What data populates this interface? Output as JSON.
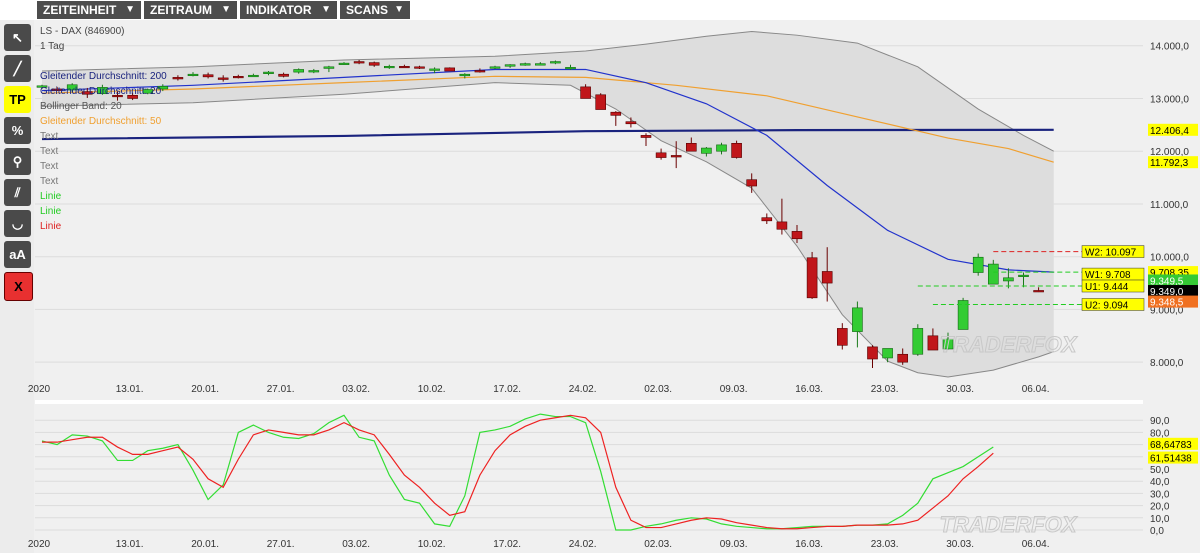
{
  "menu": [
    {
      "label": "ZEITEINHEIT"
    },
    {
      "label": "ZEITRAUM"
    },
    {
      "label": "INDIKATOR"
    },
    {
      "label": "SCANS"
    }
  ],
  "tools": [
    {
      "name": "cursor-tool-icon",
      "glyph": "↖"
    },
    {
      "name": "line-tool-icon",
      "glyph": "╱"
    },
    {
      "name": "tp-tool-button",
      "glyph": "TP"
    },
    {
      "name": "percent-tool-icon",
      "glyph": "%"
    },
    {
      "name": "zoom-tool-icon",
      "glyph": "⚲"
    },
    {
      "name": "parallel-tool-icon",
      "glyph": "⫽"
    },
    {
      "name": "curve-tool-icon",
      "glyph": "◡"
    },
    {
      "name": "text-tool-button",
      "glyph": "aA"
    },
    {
      "name": "delete-tool-button",
      "glyph": "X"
    }
  ],
  "info": {
    "symbol": "LS - DAX (846900)",
    "interval": "1 Tag"
  },
  "legend": [
    {
      "text": "Gleitender Durchschnitt: 200",
      "color": "#1a237e"
    },
    {
      "text": "Gleitender Durchschnitt: 20",
      "color": "#1a237e"
    },
    {
      "text": "Bollinger Band: 20",
      "color": "#555555"
    },
    {
      "text": "Gleitender Durchschnitt: 50",
      "color": "#f0a030"
    },
    {
      "text": "Text",
      "color": "#777777"
    },
    {
      "text": "Text",
      "color": "#777777"
    },
    {
      "text": "Text",
      "color": "#777777"
    },
    {
      "text": "Text",
      "color": "#777777"
    },
    {
      "text": "Linie",
      "color": "#22cc22"
    },
    {
      "text": "Linie",
      "color": "#22cc22"
    },
    {
      "text": "Linie",
      "color": "#dd2222"
    }
  ],
  "watermark": "TRADERFOX",
  "chart_data": [
    {
      "type": "candlestick",
      "ylim": [
        7700,
        14450
      ],
      "yticks": [
        {
          "v": 14000,
          "label": "14.000,0"
        },
        {
          "v": 13000,
          "label": "13.000,0"
        },
        {
          "v": 12000,
          "label": "12.000,0"
        },
        {
          "v": 11000,
          "label": "11.000,0"
        },
        {
          "v": 10000,
          "label": "10.000,0"
        },
        {
          "v": 9000,
          "label": "9.000,0"
        },
        {
          "v": 8000,
          "label": "8.000,0"
        }
      ],
      "xlabels": [
        {
          "i": 0,
          "label": "2020"
        },
        {
          "i": 6,
          "label": "13.01."
        },
        {
          "i": 11,
          "label": "20.01."
        },
        {
          "i": 16,
          "label": "27.01."
        },
        {
          "i": 21,
          "label": "03.02."
        },
        {
          "i": 26,
          "label": "10.02."
        },
        {
          "i": 31,
          "label": "17.02."
        },
        {
          "i": 36,
          "label": "24.02."
        },
        {
          "i": 41,
          "label": "02.03."
        },
        {
          "i": 46,
          "label": "09.03."
        },
        {
          "i": 51,
          "label": "16.03."
        },
        {
          "i": 56,
          "label": "23.03."
        },
        {
          "i": 61,
          "label": "30.03."
        },
        {
          "i": 66,
          "label": "06.04."
        }
      ],
      "ohlc": [
        [
          13220,
          13260,
          13180,
          13240
        ],
        [
          13180,
          13220,
          13140,
          13150
        ],
        [
          13160,
          13290,
          13120,
          13260
        ],
        [
          13130,
          13200,
          13010,
          13080
        ],
        [
          13090,
          13260,
          13070,
          13210
        ],
        [
          13060,
          13130,
          12960,
          13040
        ],
        [
          13060,
          13110,
          12970,
          13000
        ],
        [
          13100,
          13190,
          13080,
          13170
        ],
        [
          13180,
          13270,
          13140,
          13230
        ],
        [
          13400,
          13440,
          13340,
          13370
        ],
        [
          13460,
          13500,
          13420,
          13460
        ],
        [
          13450,
          13490,
          13380,
          13410
        ],
        [
          13390,
          13440,
          13320,
          13360
        ],
        [
          13420,
          13450,
          13380,
          13400
        ],
        [
          13440,
          13470,
          13420,
          13440
        ],
        [
          13470,
          13520,
          13440,
          13500
        ],
        [
          13460,
          13490,
          13400,
          13420
        ],
        [
          13500,
          13570,
          13470,
          13550
        ],
        [
          13520,
          13560,
          13480,
          13530
        ],
        [
          13570,
          13620,
          13500,
          13600
        ],
        [
          13660,
          13690,
          13640,
          13670
        ],
        [
          13700,
          13730,
          13650,
          13680
        ],
        [
          13680,
          13700,
          13600,
          13630
        ],
        [
          13600,
          13640,
          13560,
          13610
        ],
        [
          13610,
          13640,
          13580,
          13590
        ],
        [
          13600,
          13620,
          13560,
          13580
        ],
        [
          13540,
          13590,
          13480,
          13560
        ],
        [
          13580,
          13590,
          13520,
          13520
        ],
        [
          13430,
          13480,
          13380,
          13460
        ],
        [
          13530,
          13570,
          13490,
          13520
        ],
        [
          13590,
          13620,
          13560,
          13600
        ],
        [
          13620,
          13650,
          13580,
          13640
        ],
        [
          13650,
          13680,
          13620,
          13660
        ],
        [
          13660,
          13690,
          13630,
          13660
        ],
        [
          13690,
          13720,
          13650,
          13700
        ],
        [
          13580,
          13640,
          13540,
          13590
        ],
        [
          13220,
          13270,
          13060,
          13000
        ],
        [
          13070,
          13100,
          12890,
          12790
        ],
        [
          12740,
          12760,
          12480,
          12680
        ],
        [
          12560,
          12640,
          12450,
          12520
        ],
        [
          12300,
          12340,
          12100,
          12260
        ],
        [
          11970,
          12050,
          11840,
          11880
        ],
        [
          11920,
          12190,
          11680,
          11890
        ],
        [
          12150,
          12260,
          12020,
          12000
        ],
        [
          11960,
          12080,
          11900,
          12060
        ],
        [
          12000,
          12160,
          11940,
          12120
        ],
        [
          12150,
          12200,
          11860,
          11880
        ],
        [
          11460,
          11580,
          11210,
          11340
        ],
        [
          10740,
          10820,
          10620,
          10680
        ],
        [
          10660,
          11100,
          10420,
          10520
        ],
        [
          10480,
          10600,
          10260,
          10340
        ],
        [
          9980,
          10090,
          9200,
          9220
        ],
        [
          9720,
          10180,
          9150,
          9500
        ],
        [
          8640,
          8740,
          8240,
          8320
        ],
        [
          8580,
          9150,
          8280,
          9030
        ],
        [
          8290,
          8320,
          7890,
          8060
        ],
        [
          8080,
          8200,
          8000,
          8260
        ],
        [
          8150,
          8260,
          7950,
          8000
        ],
        [
          8150,
          8720,
          8120,
          8640
        ],
        [
          8500,
          8640,
          8240,
          8230
        ],
        [
          8250,
          8560,
          8240,
          8440
        ],
        [
          8620,
          9220,
          8750,
          9170
        ],
        [
          9700,
          10060,
          9640,
          9990
        ],
        [
          9480,
          9940,
          9500,
          9860
        ],
        [
          9540,
          9780,
          9400,
          9600
        ],
        [
          9650,
          9700,
          9420,
          9650
        ],
        [
          9360,
          9420,
          9330,
          9350
        ]
      ],
      "ma200": [
        {
          "i": 0,
          "v": 12230
        },
        {
          "i": 20,
          "v": 12290
        },
        {
          "i": 36,
          "v": 12380
        },
        {
          "i": 50,
          "v": 12400
        },
        {
          "i": 67,
          "v": 12406
        }
      ],
      "ma50": [
        {
          "i": 0,
          "v": 13100
        },
        {
          "i": 10,
          "v": 13180
        },
        {
          "i": 20,
          "v": 13300
        },
        {
          "i": 30,
          "v": 13420
        },
        {
          "i": 36,
          "v": 13400
        },
        {
          "i": 42,
          "v": 13250
        },
        {
          "i": 48,
          "v": 13050
        },
        {
          "i": 54,
          "v": 12650
        },
        {
          "i": 60,
          "v": 12250
        },
        {
          "i": 64,
          "v": 12050
        },
        {
          "i": 67,
          "v": 11792
        }
      ],
      "ma20": [
        {
          "i": 0,
          "v": 13150
        },
        {
          "i": 10,
          "v": 13250
        },
        {
          "i": 20,
          "v": 13400
        },
        {
          "i": 30,
          "v": 13550
        },
        {
          "i": 36,
          "v": 13550
        },
        {
          "i": 40,
          "v": 13300
        },
        {
          "i": 44,
          "v": 12900
        },
        {
          "i": 48,
          "v": 12300
        },
        {
          "i": 52,
          "v": 11350
        },
        {
          "i": 56,
          "v": 10500
        },
        {
          "i": 60,
          "v": 9950
        },
        {
          "i": 64,
          "v": 9750
        },
        {
          "i": 67,
          "v": 9708
        }
      ],
      "bb_upper": [
        {
          "i": 0,
          "v": 13520
        },
        {
          "i": 10,
          "v": 13600
        },
        {
          "i": 20,
          "v": 13730
        },
        {
          "i": 30,
          "v": 13800
        },
        {
          "i": 36,
          "v": 13900
        },
        {
          "i": 40,
          "v": 14030
        },
        {
          "i": 44,
          "v": 14180
        },
        {
          "i": 47,
          "v": 14270
        },
        {
          "i": 50,
          "v": 14200
        },
        {
          "i": 54,
          "v": 14050
        },
        {
          "i": 58,
          "v": 13600
        },
        {
          "i": 62,
          "v": 12800
        },
        {
          "i": 65,
          "v": 12300
        },
        {
          "i": 67,
          "v": 12000
        }
      ],
      "bb_lower": [
        {
          "i": 0,
          "v": 12850
        },
        {
          "i": 10,
          "v": 12920
        },
        {
          "i": 20,
          "v": 13080
        },
        {
          "i": 30,
          "v": 13300
        },
        {
          "i": 35,
          "v": 13250
        },
        {
          "i": 38,
          "v": 12800
        },
        {
          "i": 41,
          "v": 12200
        },
        {
          "i": 44,
          "v": 11800
        },
        {
          "i": 47,
          "v": 11300
        },
        {
          "i": 50,
          "v": 10200
        },
        {
          "i": 53,
          "v": 8900
        },
        {
          "i": 56,
          "v": 8020
        },
        {
          "i": 58,
          "v": 7800
        },
        {
          "i": 60,
          "v": 7720
        },
        {
          "i": 63,
          "v": 7850
        },
        {
          "i": 66,
          "v": 8100
        },
        {
          "i": 67,
          "v": 8200
        }
      ],
      "levels": [
        {
          "label": "W2: 10.097",
          "v": 10097,
          "color": "#dd2222",
          "from": 63
        },
        {
          "label": "W1: 9.708",
          "v": 9708,
          "color": "#22cc22",
          "from": 63
        },
        {
          "label": "U1: 9.444",
          "v": 9444,
          "color": "#22cc22",
          "from": 58
        },
        {
          "label": "U2: 9.094",
          "v": 9094,
          "color": "#22cc22",
          "from": 59
        }
      ],
      "price_tags": [
        {
          "label": "12.406,4",
          "v": 12406,
          "bg": "#ffff00",
          "fg": "#000000"
        },
        {
          "label": "11.792,3",
          "v": 11792,
          "bg": "#ffff00",
          "fg": "#000000"
        },
        {
          "label": "9.708,35",
          "v": 9708,
          "bg": "#ffff00",
          "fg": "#000000"
        },
        {
          "label": "9.349,5",
          "v": 9549,
          "bg": "#34c934",
          "fg": "#ffffff"
        },
        {
          "label": "9.349,0",
          "v": 9349,
          "bg": "#000000",
          "fg": "#ffffff"
        },
        {
          "label": "9.348,5",
          "v": 9149,
          "bg": "#f07020",
          "fg": "#ffffff"
        }
      ]
    },
    {
      "type": "line",
      "ylim": [
        0,
        100
      ],
      "yticks": [
        {
          "v": 90,
          "label": "90,0"
        },
        {
          "v": 80,
          "label": "80,0"
        },
        {
          "v": 70,
          "label": "70,0"
        },
        {
          "v": 60,
          "label": "60,0"
        },
        {
          "v": 50,
          "label": "50,0"
        },
        {
          "v": 40,
          "label": "40,0"
        },
        {
          "v": 30,
          "label": "30,0"
        },
        {
          "v": 20,
          "label": "20,0"
        },
        {
          "v": 10,
          "label": "10,0"
        },
        {
          "v": 0,
          "label": "0,0"
        }
      ],
      "xlabels": [
        {
          "i": 0,
          "label": "2020"
        },
        {
          "i": 6,
          "label": "13.01."
        },
        {
          "i": 11,
          "label": "20.01."
        },
        {
          "i": 16,
          "label": "27.01."
        },
        {
          "i": 21,
          "label": "03.02."
        },
        {
          "i": 26,
          "label": "10.02."
        },
        {
          "i": 31,
          "label": "17.02."
        },
        {
          "i": 36,
          "label": "24.02."
        },
        {
          "i": 41,
          "label": "02.03."
        },
        {
          "i": 46,
          "label": "09.03."
        },
        {
          "i": 51,
          "label": "16.03."
        },
        {
          "i": 56,
          "label": "23.03."
        },
        {
          "i": 61,
          "label": "30.03."
        },
        {
          "i": 66,
          "label": "06.04."
        }
      ],
      "series": [
        {
          "color": "#33dd33",
          "values": [
            73,
            70,
            78,
            77,
            73,
            57,
            57,
            65,
            67,
            70,
            49,
            25,
            37,
            80,
            86,
            80,
            76,
            75,
            79,
            88,
            94,
            76,
            73,
            45,
            25,
            22,
            5,
            3,
            28,
            80,
            82,
            85,
            91,
            95,
            93,
            93,
            88,
            48,
            0,
            0,
            3,
            5,
            8,
            10,
            9,
            5,
            3,
            2,
            1,
            1,
            2,
            3,
            3,
            3,
            4,
            4,
            5,
            12,
            22,
            42,
            47,
            52,
            60,
            68
          ]
        },
        {
          "color": "#ee2222",
          "values": [
            72,
            72,
            74,
            76,
            76,
            68,
            62,
            62,
            65,
            68,
            58,
            42,
            35,
            58,
            78,
            82,
            80,
            78,
            78,
            82,
            88,
            82,
            78,
            62,
            45,
            35,
            22,
            12,
            15,
            45,
            65,
            78,
            85,
            90,
            92,
            94,
            92,
            80,
            35,
            8,
            2,
            2,
            5,
            8,
            10,
            9,
            6,
            4,
            2,
            1,
            1,
            2,
            3,
            3,
            4,
            4,
            4,
            5,
            8,
            18,
            28,
            42,
            52,
            63
          ]
        }
      ],
      "value_tags": [
        {
          "label": "68,64783",
          "v": 69,
          "bg": "#ffff00"
        },
        {
          "label": "61,51438",
          "v": 61,
          "bg": "#ffff00"
        }
      ]
    }
  ]
}
